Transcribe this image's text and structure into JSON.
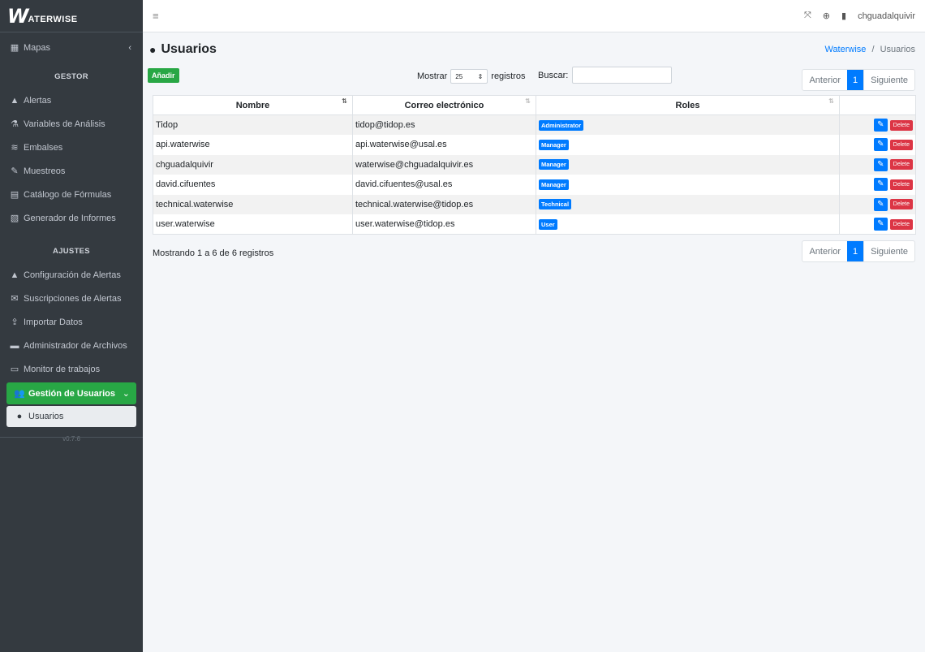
{
  "brand": {
    "text": "ATERWISE",
    "logo_letter": "W"
  },
  "sidebar": {
    "mapas": {
      "label": "Mapas",
      "icon": "map-icon"
    },
    "section_gestor": "GESTOR",
    "gestor_items": [
      {
        "label": "Alertas",
        "icon": "bell-icon"
      },
      {
        "label": "Variables de Análisis",
        "icon": "flask-icon"
      },
      {
        "label": "Embalses",
        "icon": "water-icon"
      },
      {
        "label": "Muestreos",
        "icon": "eyedropper-icon"
      },
      {
        "label": "Catálogo de Fórmulas",
        "icon": "calculator-icon"
      },
      {
        "label": "Generador de Informes",
        "icon": "file-icon"
      }
    ],
    "section_ajustes": "AJUSTES",
    "ajustes_items": [
      {
        "label": "Configuración de Alertas",
        "icon": "bell-cog-icon"
      },
      {
        "label": "Suscripciones de Alertas",
        "icon": "envelope-icon"
      },
      {
        "label": "Importar Datos",
        "icon": "upload-icon"
      },
      {
        "label": "Administrador de Archivos",
        "icon": "folder-icon"
      },
      {
        "label": "Monitor de trabajos",
        "icon": "desktop-icon"
      }
    ],
    "active_group": "Gestión de Usuarios",
    "active_sub": "Usuarios",
    "version": "v0.7.6"
  },
  "topbar": {
    "username": "chguadalquivir"
  },
  "page": {
    "title": "Usuarios",
    "breadcrumb_root": "Waterwise",
    "breadcrumb_sep": "/",
    "breadcrumb_current": "Usuarios"
  },
  "toolbar": {
    "add_label": "Añadir",
    "show_label": "Mostrar",
    "page_size": "25",
    "records_label": "registros",
    "search_label": "Buscar:",
    "search_value": ""
  },
  "pagination": {
    "prev": "Anterior",
    "current": "1",
    "next": "Siguiente"
  },
  "table": {
    "columns": [
      "Nombre",
      "Correo electrónico",
      "Roles"
    ],
    "rows": [
      {
        "name": "Tidop",
        "email": "tidop@tidop.es",
        "role": "Administrator"
      },
      {
        "name": "api.waterwise",
        "email": "api.waterwise@usal.es",
        "role": "Manager"
      },
      {
        "name": "chguadalquivir",
        "email": "waterwise@chguadalquivir.es",
        "role": "Manager"
      },
      {
        "name": "david.cifuentes",
        "email": "david.cifuentes@usal.es",
        "role": "Manager"
      },
      {
        "name": "technical.waterwise",
        "email": "technical.waterwise@tidop.es",
        "role": "Technical"
      },
      {
        "name": "user.waterwise",
        "email": "user.waterwise@tidop.es",
        "role": "User"
      }
    ],
    "delete_label": "Delete"
  },
  "info_text": "Mostrando 1 a 6 de 6 registros",
  "colors": {
    "sidebar": "#343a40",
    "accent_green": "#28a745",
    "primary": "#007bff",
    "danger": "#dc3545"
  }
}
